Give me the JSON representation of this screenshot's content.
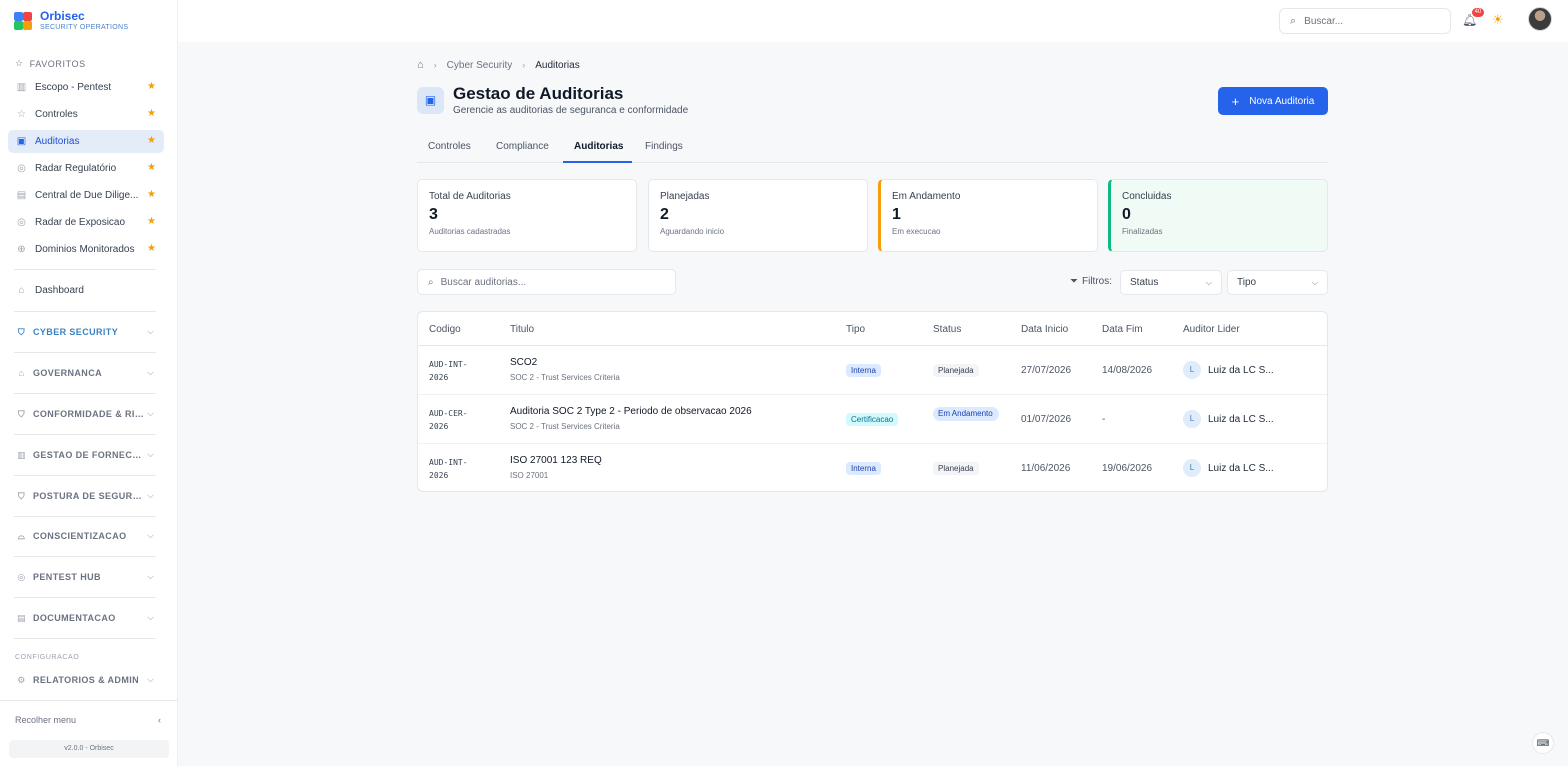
{
  "brand": {
    "name": "Orbisec",
    "subtitle": "SECURITY OPERATIONS"
  },
  "sidebar": {
    "favorites_label": "FAVORITOS",
    "favorites": [
      {
        "label": "Escopo - Pentest",
        "icon": "building-icon",
        "active": false
      },
      {
        "label": "Controles",
        "icon": "star-outline-icon",
        "active": false
      },
      {
        "label": "Auditorias",
        "icon": "clipboard-check-icon",
        "active": true
      },
      {
        "label": "Radar Regulatório",
        "icon": "radar-icon",
        "active": false
      },
      {
        "label": "Central de Due Dilige...",
        "icon": "document-icon",
        "active": false
      },
      {
        "label": "Radar de Exposicao",
        "icon": "radar-icon",
        "active": false
      },
      {
        "label": "Dominios Monitorados",
        "icon": "globe-icon",
        "active": false
      }
    ],
    "dashboard_label": "Dashboard",
    "groups": [
      {
        "label": "CYBER SECURITY",
        "icon": "shield-icon",
        "accent": true
      },
      {
        "label": "GOVERNANCA",
        "icon": "bank-icon",
        "accent": false
      },
      {
        "label": "CONFORMIDADE & RIS...",
        "icon": "shield-check-icon",
        "accent": false
      },
      {
        "label": "GESTAO DE FORNECE...",
        "icon": "building-icon",
        "accent": false
      },
      {
        "label": "POSTURA DE SEGURA...",
        "icon": "shield-check-icon",
        "accent": false
      },
      {
        "label": "CONSCIENTIZACAO",
        "icon": "graduation-cap-icon",
        "accent": false
      },
      {
        "label": "PENTEST HUB",
        "icon": "target-icon",
        "accent": false
      },
      {
        "label": "DOCUMENTACAO",
        "icon": "document-icon",
        "accent": false
      }
    ],
    "config_label": "CONFIGURACAO",
    "admin_group": {
      "label": "RELATORIOS & ADMIN",
      "icon": "gear-icon"
    },
    "collapse_label": "Recolher menu",
    "version": "v2.0.0 - Orbisec"
  },
  "topbar": {
    "search_placeholder": "Buscar...",
    "notifications_count": "40"
  },
  "breadcrumb": {
    "section": "Cyber Security",
    "current": "Auditorias"
  },
  "page": {
    "title": "Gestao de Auditorias",
    "subtitle": "Gerencie as auditorias de seguranca e conformidade",
    "new_button": "Nova Auditoria"
  },
  "tabs": [
    {
      "label": "Controles",
      "active": false
    },
    {
      "label": "Compliance",
      "active": false
    },
    {
      "label": "Auditorias",
      "active": true
    },
    {
      "label": "Findings",
      "active": false
    }
  ],
  "stats": [
    {
      "label": "Total de Auditorias",
      "value": "3",
      "sub": "Auditorias cadastradas",
      "accent": ""
    },
    {
      "label": "Planejadas",
      "value": "2",
      "sub": "Aguardando inicio",
      "accent": ""
    },
    {
      "label": "Em Andamento",
      "value": "1",
      "sub": "Em execucao",
      "accent": "#f59e0b"
    },
    {
      "label": "Concluidas",
      "value": "0",
      "sub": "Finalizadas",
      "accent": "#10b981"
    }
  ],
  "list": {
    "search_placeholder": "Buscar auditorias...",
    "filters_label": "Filtros:",
    "status_select": "Status",
    "type_select": "Tipo"
  },
  "table": {
    "headers": [
      "Codigo",
      "Titulo",
      "Tipo",
      "Status",
      "Data Inicio",
      "Data Fim",
      "Auditor Lider"
    ],
    "rows": [
      {
        "code_l1": "AUD-INT-",
        "code_l2": "2026",
        "title": "SCO2",
        "subtitle": "SOC 2 - Trust Services Criteria",
        "type": "Interna",
        "status": "Planejada",
        "start": "27/07/2026",
        "end": "14/08/2026",
        "auditor_initial": "L",
        "auditor": "Luiz da LC S..."
      },
      {
        "code_l1": "AUD-CER-",
        "code_l2": "2026",
        "title": "Auditoria SOC 2 Type 2 - Periodo de observacao 2026",
        "subtitle": "SOC 2 - Trust Services Criteria",
        "type": "Certificacao",
        "status": "Em Andamento",
        "start": "01/07/2026",
        "end": "-",
        "auditor_initial": "L",
        "auditor": "Luiz da LC S..."
      },
      {
        "code_l1": "AUD-INT-",
        "code_l2": "2026",
        "title": "ISO 27001 123 REQ",
        "subtitle": "ISO 27001",
        "type": "Interna",
        "status": "Planejada",
        "start": "11/06/2026",
        "end": "19/06/2026",
        "auditor_initial": "L",
        "auditor": "Luiz da LC S..."
      }
    ]
  }
}
